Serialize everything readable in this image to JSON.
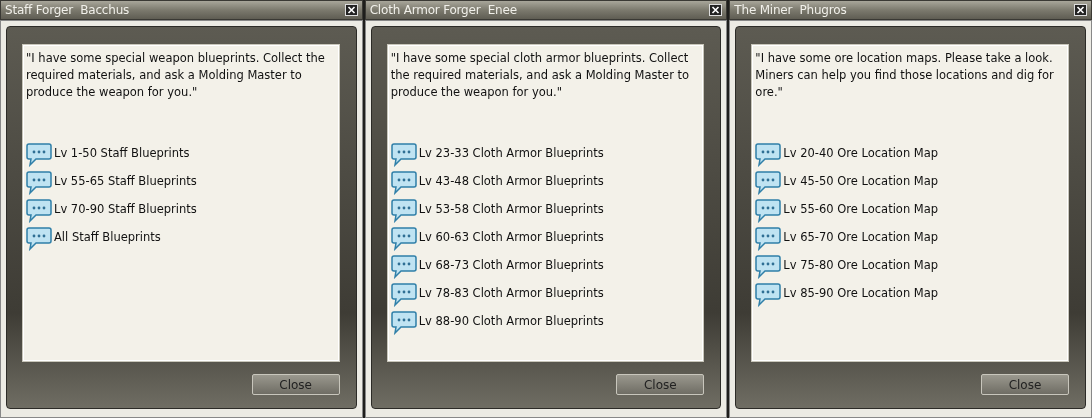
{
  "dialogs": [
    {
      "title": "Staff Forger  Bacchus",
      "message": "\"I have some special weapon blueprints. Collect the required materials, and ask a Molding Master to produce the weapon for you.\"",
      "options": [
        "Lv 1-50 Staff Blueprints",
        "Lv 55-65 Staff Blueprints",
        "Lv 70-90 Staff Blueprints",
        "All Staff Blueprints"
      ],
      "button": "Close"
    },
    {
      "title": "Cloth Armor Forger  Enee",
      "message": "\"I have some special cloth armor blueprints. Collect the required materials, and ask a Molding Master to produce the weapon for you.\"",
      "options": [
        "Lv 23-33 Cloth Armor Blueprints",
        "Lv 43-48 Cloth Armor Blueprints",
        "Lv 53-58 Cloth Armor Blueprints",
        "Lv 60-63 Cloth Armor Blueprints",
        "Lv 68-73 Cloth Armor Blueprints",
        "Lv 78-83 Cloth Armor Blueprints",
        "Lv 88-90 Cloth Armor Blueprints"
      ],
      "button": "Close"
    },
    {
      "title": "The Miner  Phugros",
      "message": "\"I have some ore location maps. Please take a look. Miners can help you find those locations and dig for ore.\"",
      "options": [
        "Lv 20-40 Ore Location Map",
        "Lv 45-50 Ore Location Map",
        "Lv 55-60 Ore Location Map",
        "Lv 65-70 Ore Location Map",
        "Lv 75-80 Ore Location Map",
        "Lv 85-90 Ore Location Map"
      ],
      "button": "Close"
    }
  ]
}
